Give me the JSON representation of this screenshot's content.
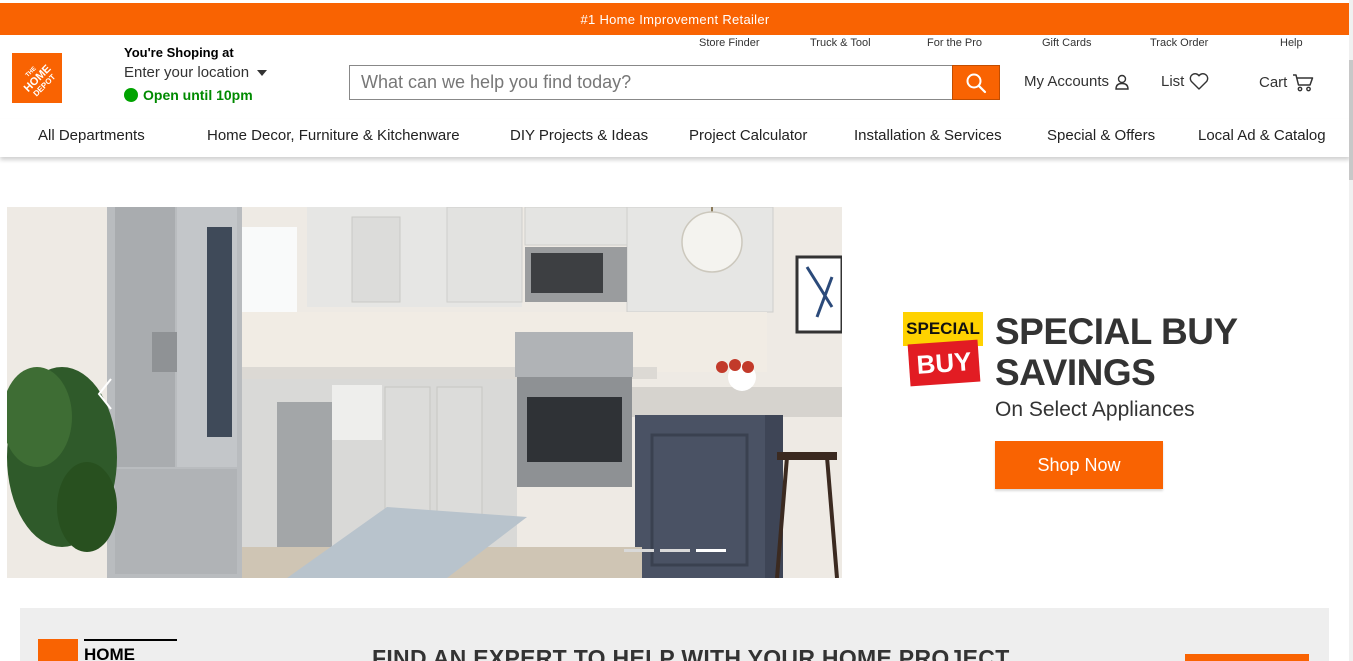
{
  "promo_bar": {
    "text": "#1 Home Improvement Retailer"
  },
  "store": {
    "title": "You're Shoping at",
    "location": "Enter your location",
    "hours": "Open until 10pm"
  },
  "utility_links": [
    "Store Finder",
    "Truck & Tool",
    "For the Pro",
    "Gift Cards",
    "Track Order",
    "Help"
  ],
  "search": {
    "placeholder": "What can we help you find today?"
  },
  "account": {
    "accounts_label": "My Accounts",
    "list_label": "List",
    "cart_label": "Cart"
  },
  "nav": [
    "All Departments",
    "Home Decor, Furniture & Kitchenware",
    "DIY Projects & Ideas",
    "Project Calculator",
    "Installation & Services",
    "Special & Offers",
    "Local Ad & Catalog"
  ],
  "hero": {
    "badge_top": "SPECIAL",
    "badge_bottom": "BUY",
    "title_line1": "SPECIAL BUY",
    "title_line2": "SAVINGS",
    "subtitle": "On Select Appliances",
    "cta": "Shop Now",
    "carousel_active_index": 3,
    "carousel_count": 3
  },
  "expert": {
    "logo_text": "HOME",
    "headline": "FIND AN EXPERT TO HELP WITH YOUR HOME PROJECT"
  },
  "colors": {
    "brand_orange": "#f96302",
    "open_green": "#00a300",
    "badge_yellow": "#ffd200",
    "badge_red": "#e21c23"
  }
}
